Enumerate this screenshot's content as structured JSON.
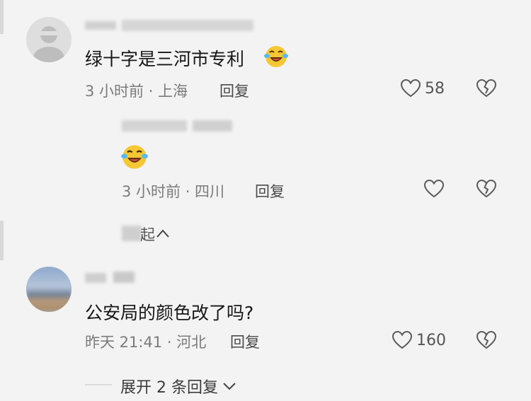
{
  "comments": [
    {
      "text": "绿十字是三河市专利",
      "time": "3 小时前 · 上海",
      "reply_label": "回复",
      "like_count": "58",
      "emoji": "laughing-tears"
    },
    {
      "text": "",
      "time": "3 小时前 · 四川",
      "reply_label": "回复",
      "like_count": "",
      "emoji": "laughing-tears"
    },
    {
      "text": "公安局的颜色改了吗?",
      "time": "昨天 21:41 · 河北",
      "reply_label": "回复",
      "like_count": "160"
    }
  ],
  "collapse": {
    "label": "起",
    "arrow": "^"
  },
  "expand_replies": {
    "label": "展开 2 条回复",
    "arrow": "⌄"
  },
  "colors": {
    "background": "#f3f3f3",
    "text": "#161616",
    "meta": "#7b7b7b"
  }
}
